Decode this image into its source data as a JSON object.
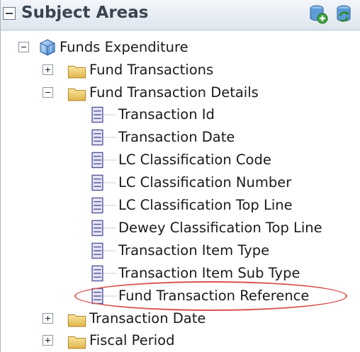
{
  "header": {
    "title": "Subject Areas",
    "icons": [
      "add-subject-area-icon",
      "refresh-icon"
    ]
  },
  "tree": {
    "root": {
      "label": "Funds Expenditure",
      "icon": "cube-icon",
      "expanded": true
    },
    "folders": [
      {
        "label": "Fund Transactions",
        "expanded": false
      },
      {
        "label": "Fund Transaction Details",
        "expanded": true
      },
      {
        "label": "Transaction Date",
        "expanded": false
      },
      {
        "label": "Fiscal Period",
        "expanded": false
      }
    ],
    "columns": [
      "Transaction Id",
      "Transaction Date",
      "LC Classification Code",
      "LC Classification Number",
      "LC Classification Top Line",
      "Dewey Classification Top Line",
      "Transaction Item Type",
      "Transaction Item Sub Type",
      "Fund Transaction Reference"
    ]
  },
  "annotation": {
    "highlight_color": "#d9534f",
    "highlighted_item": "Fund Transaction Reference"
  },
  "colors": {
    "header_bg": "#dde5ee",
    "folder": "#e6c25a",
    "column_icon": "#5a5aa8"
  }
}
